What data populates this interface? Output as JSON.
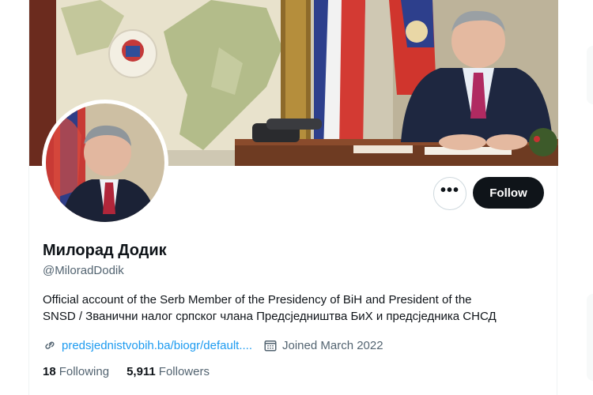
{
  "profile": {
    "name": "Милорад Додик",
    "handle": "@MiloradDodik",
    "bio_line1": "Official account of the Serb Member of the Presidency of BiH and President of the",
    "bio_line2": "SNSD / Званични налог српског члана Предсједништва БиХ и предсједника СНСД",
    "website": "predsjednistvobih.ba/biogr/default....",
    "joined": "Joined March 2022",
    "following_count": "18",
    "following_label": "Following",
    "followers_count": "5,911",
    "followers_label": "Followers"
  },
  "actions": {
    "more_label": "•••",
    "follow_label": "Follow"
  },
  "icons": {
    "more": "more-icon",
    "link": "link-icon",
    "calendar": "calendar-icon"
  },
  "colors": {
    "link": "#1d9bf0",
    "primary_text": "#0f1419",
    "secondary_text": "#536471",
    "follow_button": "#0f1419"
  }
}
